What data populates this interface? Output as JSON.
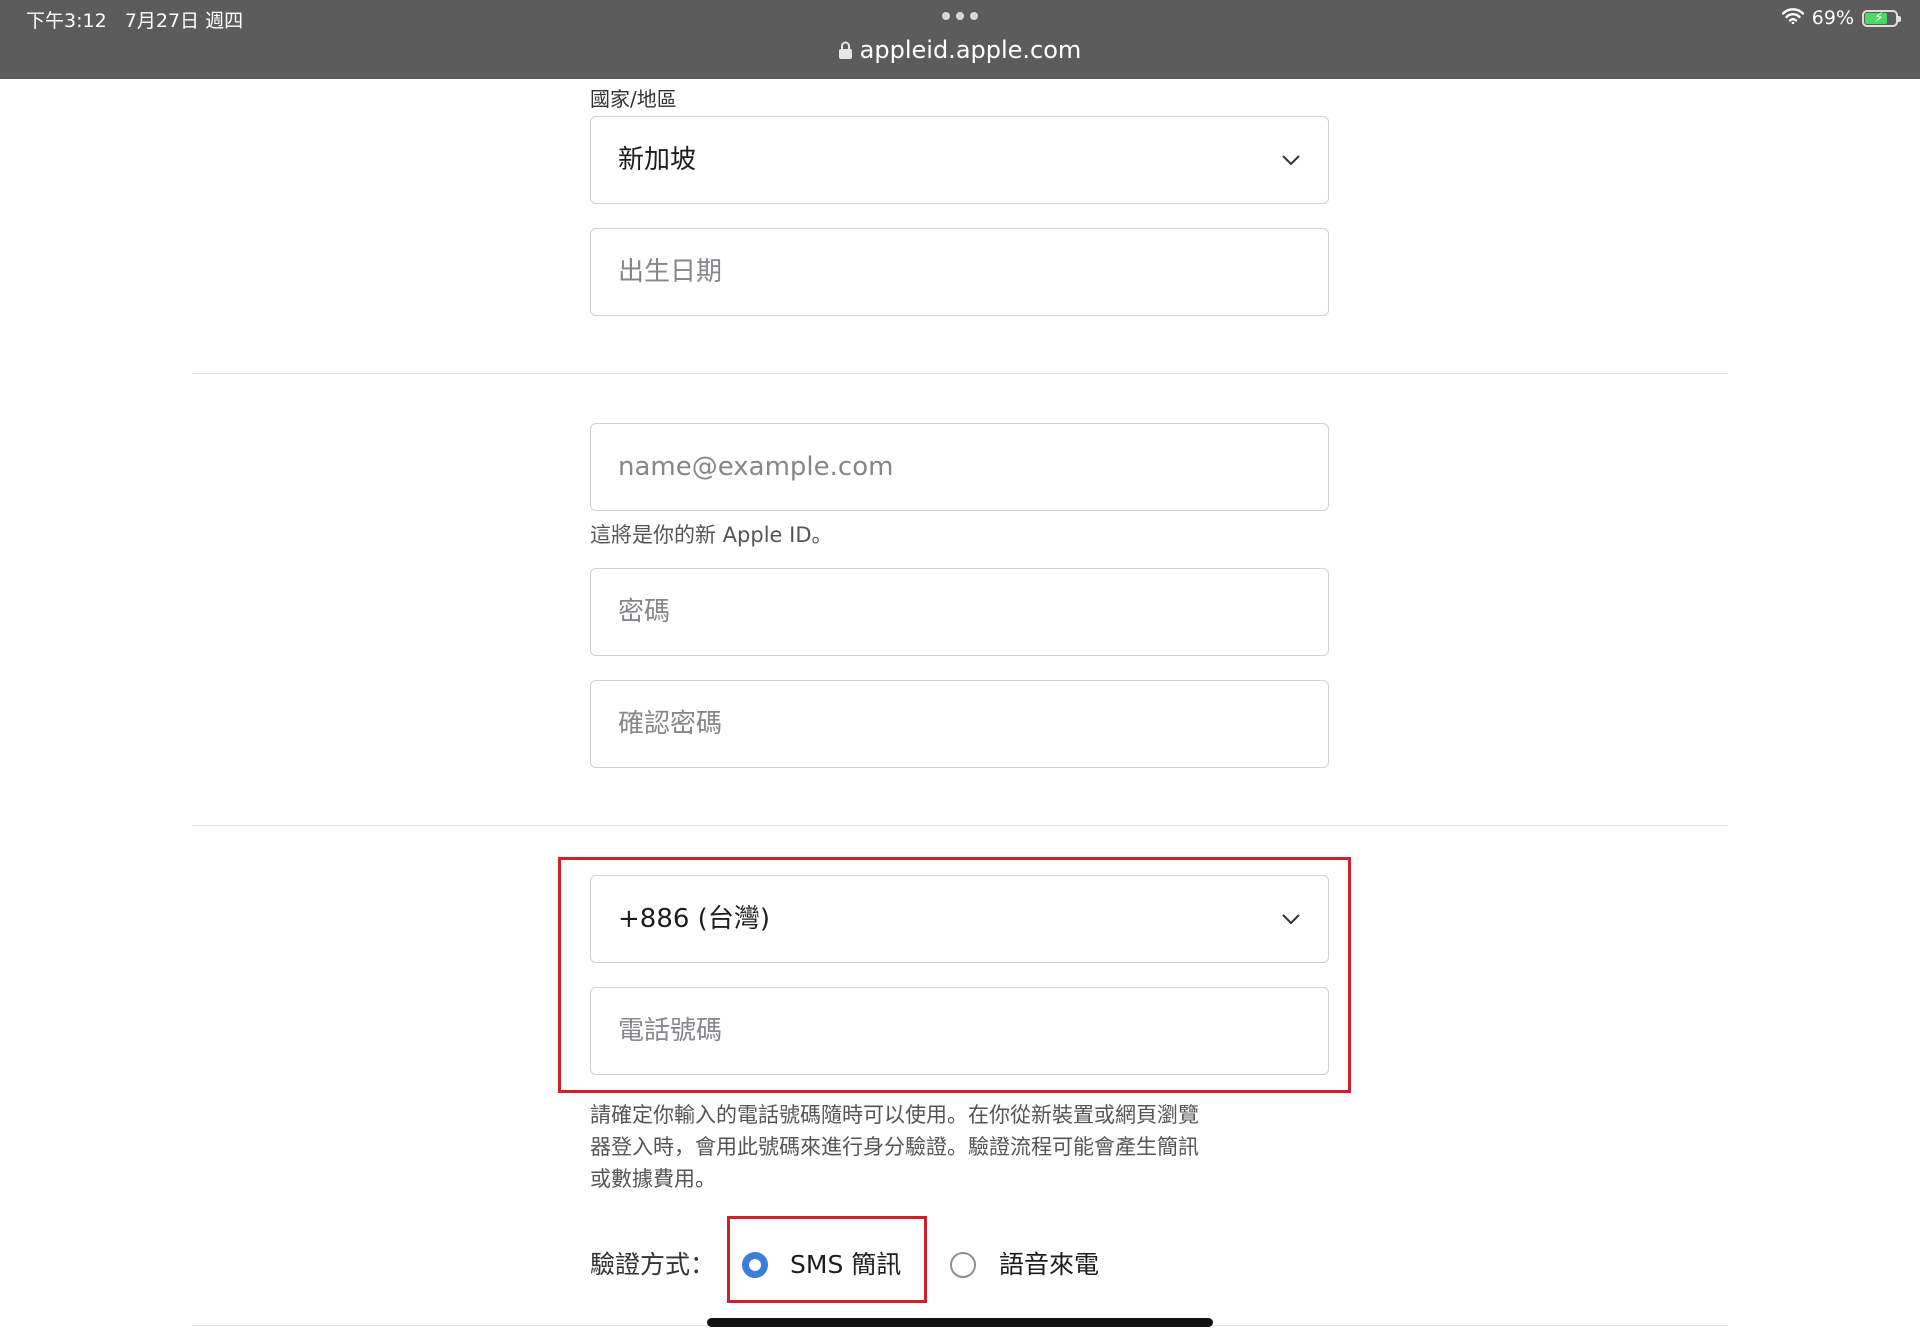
{
  "status_bar": {
    "time": "下午3:12",
    "date": "7月27日 週四",
    "url": "appleid.apple.com",
    "battery": "69%",
    "battery_level": 0.69,
    "icons": [
      "lock-icon",
      "wifi-icon",
      "battery-icon",
      "more-dots-icon"
    ]
  },
  "form": {
    "country_label": "國家/地區",
    "country_value": "新加坡",
    "birthday_placeholder": "出生日期",
    "email_placeholder": "name@example.com",
    "email_hint": "這將是你的新 Apple ID。",
    "password_placeholder": "密碼",
    "confirm_password_placeholder": "確認密碼",
    "phone_country_value": "+886 (台灣)",
    "phone_placeholder": "電話號碼",
    "phone_hint": [
      "請確定你輸入的電話號碼隨時可以使用。在你從新裝置或網頁瀏覽",
      "器登入時，會用此號碼來進行身分驗證。驗證流程可能會產生簡訊",
      "或數據費用。"
    ],
    "verify_label": "驗證方式：",
    "verify_options": [
      {
        "label": "SMS 簡訊",
        "selected": true
      },
      {
        "label": "語音來電",
        "selected": false
      }
    ]
  },
  "colors": {
    "highlight": "#d0202c",
    "radio_selected": "#3a7ddb",
    "status_bar": "#5c5c5c"
  }
}
